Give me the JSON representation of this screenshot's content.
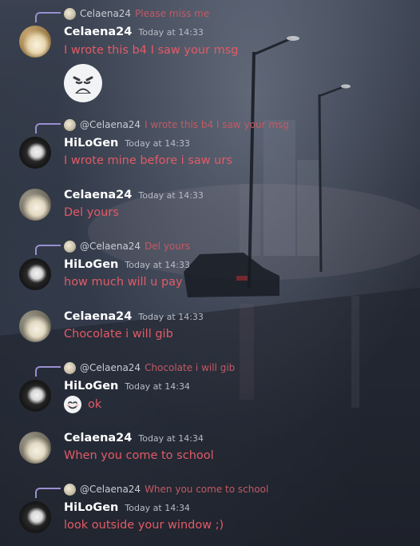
{
  "messages": [
    {
      "reply": {
        "user": "Celaena24",
        "text": "Please miss me"
      },
      "username": "Celaena24",
      "timestamp": "Today at 14:33",
      "text": "I wrote this b4 I saw your msg",
      "emoji": "weary-face-emoji"
    },
    {
      "reply": {
        "user": "@Celaena24",
        "text": "I wrote this b4 I saw your msg"
      },
      "username": "HiLoGen",
      "timestamp": "Today at 14:33",
      "text": "I wrote mine before i saw urs"
    },
    {
      "username": "Celaena24",
      "timestamp": "Today at 14:33",
      "text": "Del yours"
    },
    {
      "reply": {
        "user": "@Celaena24",
        "text": "Del yours"
      },
      "username": "HiLoGen",
      "timestamp": "Today at 14:33",
      "text": "how much will u pay"
    },
    {
      "username": "Celaena24",
      "timestamp": "Today at 14:33",
      "text": "Chocolate i will gib"
    },
    {
      "reply": {
        "user": "@Celaena24",
        "text": "Chocolate i will gib"
      },
      "username": "HiLoGen",
      "timestamp": "Today at 14:34",
      "text": "ok",
      "emoji": "smiling-face-emoji"
    },
    {
      "username": "Celaena24",
      "timestamp": "Today at 14:34",
      "text": "When you come to school"
    },
    {
      "reply": {
        "user": "@Celaena24",
        "text": "When you come to school"
      },
      "username": "HiLoGen",
      "timestamp": "Today at 14:34",
      "text": "look outside your window ;)"
    }
  ],
  "colors": {
    "message_text": "#e35a66",
    "reply_text": "#c25a64",
    "username": "#ffffff",
    "reply_line": "#9a8fd0"
  }
}
